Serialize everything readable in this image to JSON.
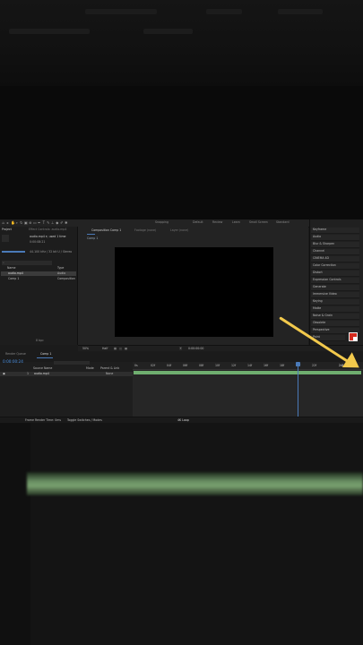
{
  "toolbar": {
    "snapping": "Snapping",
    "workspaces": [
      "Default",
      "Review",
      "Learn",
      "Small Screen",
      "Standard"
    ],
    "search_help": "Search Help"
  },
  "project_panel": {
    "tab": "Project",
    "effect_controls_tab": "Effect Controls: audio.mp4",
    "file_name": "audio.mp4",
    "file_info": "audio.mp4 ▾, used 1 time",
    "duration": "0:00:08:21",
    "audio_info": "44.100 kHz / 32 bit U / Stereo",
    "search_placeholder": "⌕",
    "columns": {
      "name": "Name",
      "type": "Type"
    },
    "items": [
      {
        "name": "audio.mp4",
        "type": "Audio"
      },
      {
        "name": "Comp 1",
        "type": "Composition"
      }
    ],
    "bit_depth": "8 bpc"
  },
  "composition_panel": {
    "tab": "Composition Comp 1",
    "footage_tab": "Footage (none)",
    "layer_tab": "Layer (none)",
    "sub_tab": "Comp 1",
    "zoom": "50%",
    "resolution": "Half",
    "timecode": "0:00:00:00"
  },
  "effects_panel": {
    "items": [
      "Keyframe",
      "Audio",
      "Blur & Sharpen",
      "Channel",
      "CINEMA 4D",
      "Color Correction",
      "Distort",
      "Expression Controls",
      "Generate",
      "Immersive Video",
      "Keying",
      "Matte",
      "Noise & Grain",
      "Obsolete",
      "Perspective",
      "Paint"
    ]
  },
  "timeline": {
    "render_queue_tab": "Render Queue",
    "comp_tab": "Comp 1",
    "current_time": "0:00:00:24",
    "columns": {
      "source_name": "Source Name",
      "mode": "Mode",
      "parent": "Parent & Link"
    },
    "layers": [
      {
        "index": "1",
        "name": "audio.mp4",
        "parent": "None"
      }
    ],
    "ruler_ticks": [
      "0s",
      "02f",
      "04f",
      "06f",
      "08f",
      "10f",
      "12f",
      "14f",
      "16f",
      "18f",
      "20f",
      "22f",
      "24f"
    ],
    "status_render": "Frame Render Time: 0ms",
    "status_toggle": "Toggle Switches / Modes"
  },
  "bottom_label": "4K Loop",
  "colors": {
    "arrow": "#f2c94c",
    "track": "#6fae6f",
    "playhead": "#4a7ab8",
    "current_time": "#4a90e2",
    "fg_swatch": "#d52b1e",
    "bg_swatch": "#ffffff"
  }
}
